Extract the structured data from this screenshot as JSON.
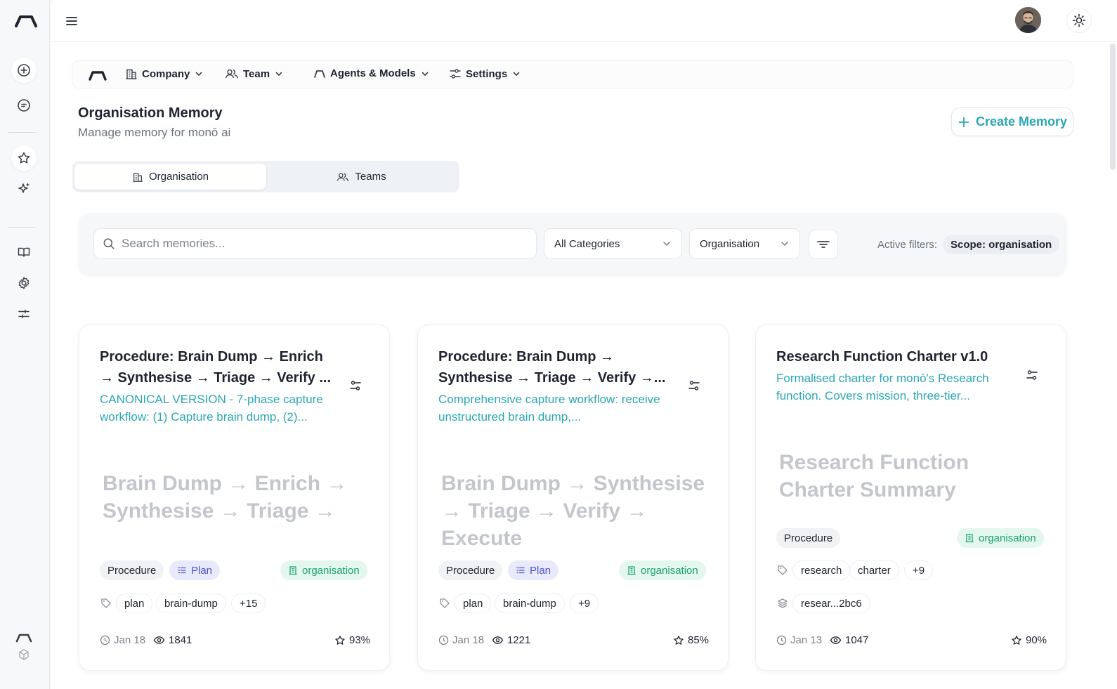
{
  "rail": {
    "icons": [
      "logo-icon",
      "new-chat-icon",
      "chat-icon",
      "star-icon",
      "sparkle-icon",
      "book-icon",
      "gear-icon",
      "sliders-icon",
      "logo-small-icon",
      "cube-icon"
    ]
  },
  "topbar": {
    "menu_icon": "hamburger-icon",
    "theme_icon": "sun-icon"
  },
  "nav": {
    "items": [
      {
        "label": "Company",
        "icon": "building-icon"
      },
      {
        "label": "Team",
        "icon": "users-icon"
      },
      {
        "label": "Agents & Models",
        "icon": "agent-icon"
      },
      {
        "label": "Settings",
        "icon": "sliders-icon"
      }
    ]
  },
  "page": {
    "title": "Organisation Memory",
    "subtitle": "Manage memory for monō ai",
    "create_label": "Create Memory"
  },
  "tabs": [
    {
      "label": "Organisation",
      "active": true
    },
    {
      "label": "Teams",
      "active": false
    }
  ],
  "filters": {
    "search_placeholder": "Search memories...",
    "category_value": "All Categories",
    "scope_value": "Organisation",
    "active_label": "Active filters:",
    "active_chip": "Scope: organisation"
  },
  "cards": [
    {
      "title": "Procedure: Brain Dump → Enrich → Synthesise → Triage → Verify ...",
      "description": "CANONICAL VERSION - 7-phase capture workflow: (1) Capture brain dump, (2)...",
      "preview": "Brain Dump → Enrich → Synthesise → Triage →",
      "category": "Procedure",
      "type": "Plan",
      "scope": "organisation",
      "tags": [
        "plan",
        "brain-dump",
        "+15"
      ],
      "date": "Jan 18",
      "views": "1841",
      "score": "93%"
    },
    {
      "title": "Procedure: Brain Dump → Synthesise → Triage → Verify →...",
      "description": "Comprehensive capture workflow: receive unstructured brain dump,...",
      "preview": "Brain Dump → Synthesise → Triage → Verify → Execute",
      "category": "Procedure",
      "type": "Plan",
      "scope": "organisation",
      "tags": [
        "plan",
        "brain-dump",
        "+9"
      ],
      "date": "Jan 18",
      "views": "1221",
      "score": "85%"
    },
    {
      "title": "Research Function Charter v1.0",
      "description": "Formalised charter for monō's Research function. Covers mission, three-tier...",
      "preview": "Research Function Charter Summary",
      "category": "Procedure",
      "scope": "organisation",
      "tags": [
        "research",
        "charter",
        "+9"
      ],
      "source": "resear...2bc6",
      "date": "Jan 13",
      "views": "1047",
      "score": "90%"
    }
  ],
  "colors": {
    "accent": "#2aa7b3",
    "scope_green": "#18a36d",
    "plan_indigo": "#4f55c9"
  }
}
